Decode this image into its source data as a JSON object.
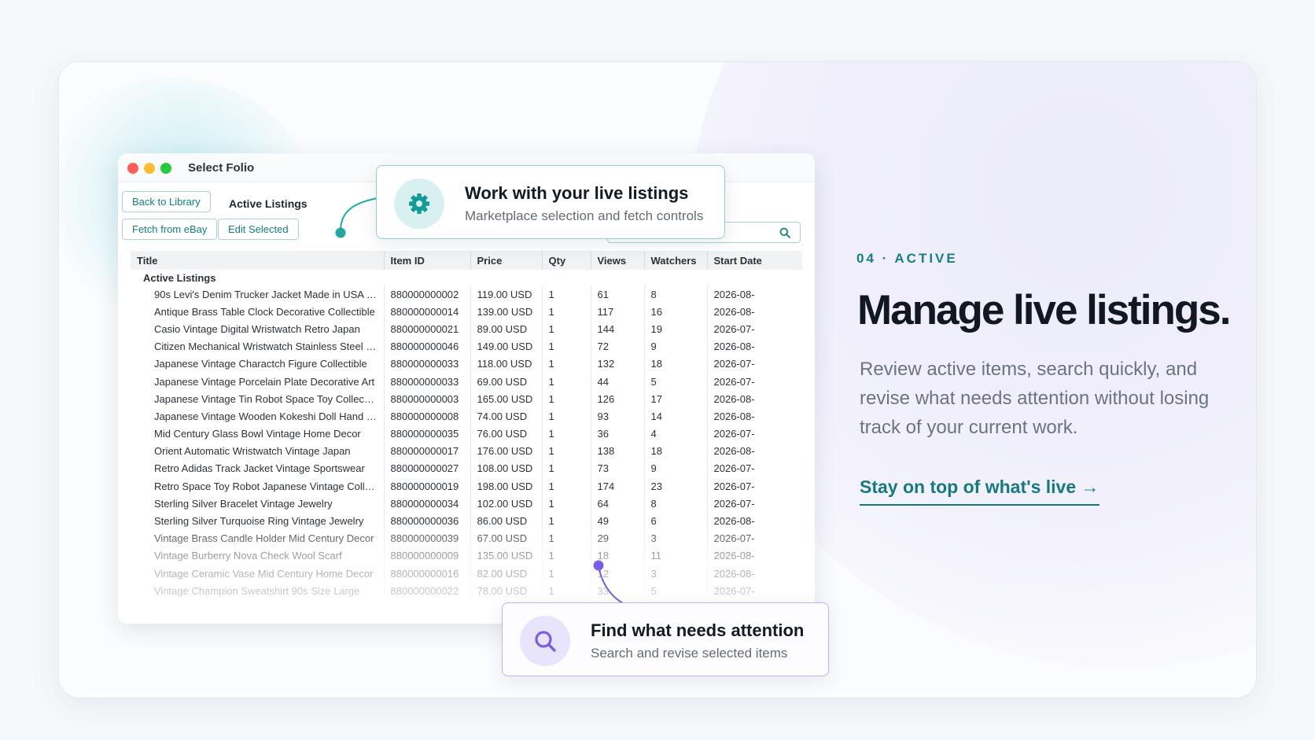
{
  "window": {
    "title": "Select Folio",
    "back_button": "Back to Library",
    "tab_label": "Active Listings",
    "fetch_button": "Fetch from eBay",
    "edit_button": "Edit Selected"
  },
  "table": {
    "columns": [
      "Title",
      "Item ID",
      "Price",
      "Qty",
      "Views",
      "Watchers",
      "Start Date"
    ],
    "group_label": "Active Listings",
    "rows": [
      [
        "90s Levi's Denim Trucker Jacket Made in USA Size...",
        "880000000002",
        "119.00 USD",
        "1",
        "61",
        "8",
        "2026-08-"
      ],
      [
        "Antique Brass Table Clock Decorative Collectible",
        "880000000014",
        "139.00 USD",
        "1",
        "117",
        "16",
        "2026-08-"
      ],
      [
        "Casio Vintage Digital Wristwatch Retro Japan",
        "880000000021",
        "89.00 USD",
        "1",
        "144",
        "19",
        "2026-07-"
      ],
      [
        "Citizen Mechanical Wristwatch Stainless Steel Vint...",
        "880000000046",
        "149.00 USD",
        "1",
        "72",
        "9",
        "2026-08-"
      ],
      [
        "Japanese Vintage Charactch Figure Collectible",
        "880000000033",
        "118.00 USD",
        "1",
        "132",
        "18",
        "2026-07-"
      ],
      [
        "Japanese Vintage Porcelain Plate Decorative Art",
        "880000000033",
        "69.00 USD",
        "1",
        "44",
        "5",
        "2026-07-"
      ],
      [
        "Japanese Vintage Tin Robot Space Toy Collectible",
        "880000000003",
        "165.00 USD",
        "1",
        "126",
        "17",
        "2026-08-"
      ],
      [
        "Japanese Vintage Wooden Kokeshi Doll Hand Pain...",
        "880000000008",
        "74.00 USD",
        "1",
        "93",
        "14",
        "2026-08-"
      ],
      [
        "Mid Century Glass Bowl Vintage Home Decor",
        "880000000035",
        "76.00 USD",
        "1",
        "36",
        "4",
        "2026-07-"
      ],
      [
        "Orient Automatic Wristwatch Vintage Japan",
        "880000000017",
        "176.00 USD",
        "1",
        "138",
        "18",
        "2026-08-"
      ],
      [
        "Retro Adidas Track Jacket Vintage Sportswear",
        "880000000027",
        "108.00 USD",
        "1",
        "73",
        "9",
        "2026-07-"
      ],
      [
        "Retro Space Toy Robot Japanese Vintage Collectib...",
        "880000000019",
        "198.00 USD",
        "1",
        "174",
        "23",
        "2026-07-"
      ],
      [
        "Sterling Silver Bracelet Vintage Jewelry",
        "880000000034",
        "102.00 USD",
        "1",
        "64",
        "8",
        "2026-07-"
      ],
      [
        "Sterling Silver Turquoise Ring Vintage Jewelry",
        "880000000036",
        "86.00 USD",
        "1",
        "49",
        "6",
        "2026-08-"
      ],
      [
        "Vintage Brass Candle Holder Mid Century Decor",
        "880000000039",
        "67.00 USD",
        "1",
        "29",
        "3",
        "2026-07-"
      ],
      [
        "Vintage Burberry Nova Check Wool Scarf",
        "880000000009",
        "135.00 USD",
        "1",
        "18",
        "11",
        "2026-08-"
      ],
      [
        "Vintage Ceramic Vase Mid Century Home Decor",
        "880000000016",
        "82.00 USD",
        "1",
        "12",
        "3",
        "2026-08-"
      ],
      [
        "Vintage Champion Sweatshirt 90s Size Large",
        "880000000022",
        "78.00 USD",
        "1",
        "33",
        "5",
        "2026-07-"
      ]
    ]
  },
  "callouts": {
    "top": {
      "title": "Work with your live listings",
      "subtitle": "Marketplace selection and fetch controls",
      "icon": "gear-icon"
    },
    "bottom": {
      "title": "Find what needs attention",
      "subtitle": "Search and revise selected items",
      "icon": "search-icon"
    }
  },
  "hero": {
    "eyebrow": "04 · ACTIVE",
    "headline": "Manage live listings.",
    "body": "Review active items, search quickly, and revise what needs attention without losing track of your current work.",
    "cta": "Stay on top of what's live →"
  },
  "colors": {
    "accent_teal": "#147a82",
    "accent_purple": "#7b5ce6",
    "button_border": "#a9d2d0"
  }
}
